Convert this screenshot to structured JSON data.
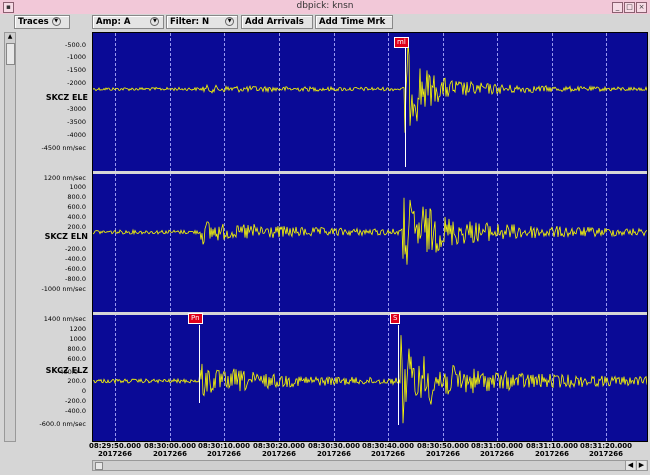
{
  "window": {
    "title": "dbpick: knsn"
  },
  "toolbar": {
    "traces": "Traces",
    "amp": "Amp: A",
    "filter": "Filter: N",
    "add_arrivals": "Add Arrivals",
    "add_time_mark": "Add Time Mrk"
  },
  "colors": {
    "plot_bg": "#0a0a96",
    "trace": "#ffff00",
    "pick_label_bg": "#e0001a"
  },
  "channels": [
    {
      "name": "SKCZ ELE",
      "unit_label": "-4500 nm/sec",
      "ticks": [
        "-500.0",
        "-1000",
        "-1500",
        "-2000",
        "-3000",
        "-3500",
        "-4000"
      ]
    },
    {
      "name": "SKCZ ELN",
      "unit_label": "1200 nm/sec",
      "ticks": [
        "1000",
        "800.0",
        "600.0",
        "400.0",
        "200.0",
        "-200.0",
        "-400.0",
        "-600.0",
        "-800.0",
        "-1000 nm/sec"
      ]
    },
    {
      "name": "SKCZ ELZ",
      "unit_label": "1400 nm/sec",
      "ticks": [
        "1200",
        "1000",
        "800.0",
        "600.0",
        "400.0",
        "200.0",
        "0",
        "-200.0",
        "-400.0",
        "-600.0 nm/sec"
      ]
    }
  ],
  "picks": [
    {
      "label": "ml",
      "channel": 0
    },
    {
      "label": "Pn",
      "channel": 2
    },
    {
      "label": "S",
      "channel": 2
    }
  ],
  "time_axis": {
    "times": [
      "08:29:50.000",
      "08:30:00.000",
      "08:30:10.000",
      "08:30:20.000",
      "08:30:30.000",
      "08:30:40.000",
      "08:30:50.000",
      "08:31:00.000",
      "08:31:10.000",
      "08:31:20.000"
    ],
    "date": "2017266"
  }
}
